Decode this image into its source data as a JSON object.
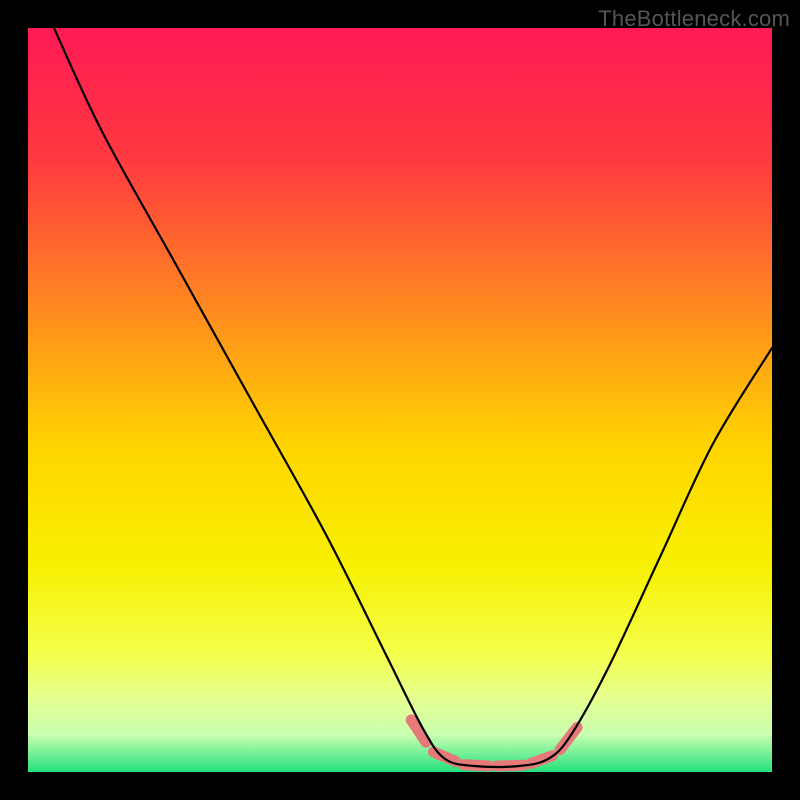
{
  "watermark": "TheBottleneck.com",
  "chart_data": {
    "type": "line",
    "title": "",
    "xlabel": "",
    "ylabel": "",
    "xlim": [
      0,
      100
    ],
    "ylim": [
      0,
      100
    ],
    "background_gradient_stops": [
      {
        "offset": 0.0,
        "color": "#ff1a55"
      },
      {
        "offset": 0.18,
        "color": "#ff3a3f"
      },
      {
        "offset": 0.38,
        "color": "#ff8b1f"
      },
      {
        "offset": 0.56,
        "color": "#ffd400"
      },
      {
        "offset": 0.72,
        "color": "#f8f000"
      },
      {
        "offset": 0.84,
        "color": "#f3ff4a"
      },
      {
        "offset": 0.9,
        "color": "#e6ff8f"
      },
      {
        "offset": 0.95,
        "color": "#c8ffb0"
      },
      {
        "offset": 1.0,
        "color": "#24e07c"
      }
    ],
    "series": [
      {
        "name": "bottleneck-curve",
        "points": [
          {
            "x": 3.5,
            "y": 100
          },
          {
            "x": 10,
            "y": 86
          },
          {
            "x": 20,
            "y": 68
          },
          {
            "x": 30,
            "y": 50
          },
          {
            "x": 40,
            "y": 32
          },
          {
            "x": 48,
            "y": 16
          },
          {
            "x": 53,
            "y": 6
          },
          {
            "x": 56,
            "y": 1.8
          },
          {
            "x": 60,
            "y": 0.8
          },
          {
            "x": 66,
            "y": 0.8
          },
          {
            "x": 70,
            "y": 1.8
          },
          {
            "x": 73,
            "y": 5
          },
          {
            "x": 78,
            "y": 14
          },
          {
            "x": 85,
            "y": 29
          },
          {
            "x": 92,
            "y": 44
          },
          {
            "x": 100,
            "y": 57
          }
        ]
      }
    ],
    "pink_band": {
      "color": "#e67a7a",
      "segments": [
        {
          "x1": 51.5,
          "y1": 7.0,
          "x2": 53.5,
          "y2": 4.0
        },
        {
          "x1": 54.5,
          "y1": 2.7,
          "x2": 57.5,
          "y2": 1.4
        },
        {
          "x1": 58.5,
          "y1": 1.0,
          "x2": 62.0,
          "y2": 0.8
        },
        {
          "x1": 63.0,
          "y1": 0.8,
          "x2": 66.5,
          "y2": 0.9
        },
        {
          "x1": 67.5,
          "y1": 1.1,
          "x2": 70.5,
          "y2": 2.2
        },
        {
          "x1": 71.5,
          "y1": 3.0,
          "x2": 73.8,
          "y2": 6.0
        }
      ]
    }
  }
}
